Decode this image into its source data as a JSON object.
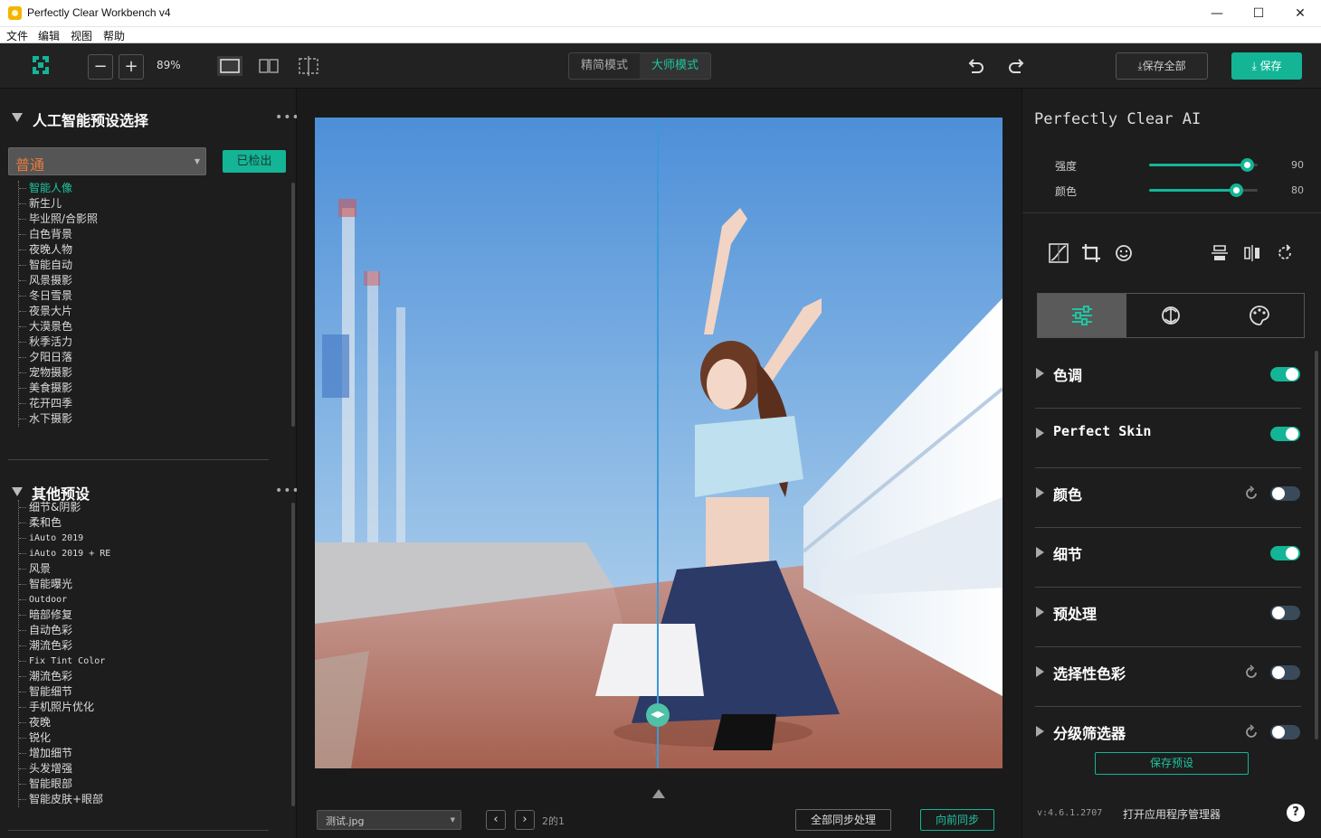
{
  "window": {
    "title": "Perfectly Clear Workbench v4",
    "minimize_glyph": "—",
    "maximize_glyph": "☐",
    "close_glyph": "✕"
  },
  "menu": [
    "文件",
    "编辑",
    "视图",
    "帮助"
  ],
  "toolbar": {
    "zoom": "89%",
    "zoom_out_glyph": "−",
    "zoom_in_glyph": "+",
    "mode_simple": "精简模式",
    "mode_master": "大师模式",
    "save_all": "⤓保存全部",
    "save": "⤓ 保存",
    "accent": "#13b596"
  },
  "left": {
    "ai_section_title": "人工智能预设选择",
    "dots": "•••",
    "preset_selected": "普通",
    "detected_button": "已检出",
    "ai_presets": [
      "智能人像",
      "新生儿",
      "毕业照/合影照",
      "白色背景",
      "夜晚人物",
      "智能自动",
      "风景摄影",
      "冬日雪景",
      "夜景大片",
      "大漠景色",
      "秋季活力",
      "夕阳日落",
      "宠物摄影",
      "美食摄影",
      "花开四季",
      "水下摄影"
    ],
    "other_section_title": "其他预设",
    "other_presets": [
      "细节&阴影",
      "柔和色",
      "iAuto 2019",
      "iAuto 2019 + RE",
      "风景",
      "智能曝光",
      "Outdoor",
      "暗部修复",
      "自动色彩",
      "潮流色彩",
      "Fix Tint Color",
      "潮流色彩",
      "智能细节",
      "手机照片优化",
      "夜晚",
      "锐化",
      "增加细节",
      "头发增强",
      "智能眼部",
      "智能皮肤+眼部"
    ]
  },
  "center": {
    "file_name": "测试.jpg",
    "prev_glyph": "‹",
    "next_glyph": "›",
    "page": "2的1",
    "handle_glyph": "◀▶",
    "sync_all": "全部同步处理",
    "sync_forward": "向前同步"
  },
  "right": {
    "ai_title": "Perfectly Clear AI",
    "sliders": [
      {
        "label": "强度",
        "value": 90,
        "display": "90"
      },
      {
        "label": "颜色",
        "value": 80,
        "display": "80"
      }
    ],
    "tools": [
      "curves-icon",
      "crop-icon",
      "face-icon",
      "flip-vertical-icon",
      "flip-horizontal-icon",
      "rotate-icon"
    ],
    "tabs": [
      "adjustments-tab",
      "ai-tab",
      "creative-tab"
    ],
    "adjustments": [
      {
        "label": "色调",
        "on": true,
        "reset": false
      },
      {
        "label": "Perfect Skin",
        "on": true,
        "reset": false
      },
      {
        "label": "颜色",
        "on": false,
        "reset": true
      },
      {
        "label": "细节",
        "on": true,
        "reset": false
      },
      {
        "label": "预处理",
        "on": false,
        "reset": false
      },
      {
        "label": "选择性色彩",
        "on": false,
        "reset": true
      },
      {
        "label": "分级筛选器",
        "on": false,
        "reset": true
      }
    ],
    "save_preset": "保存预设",
    "version": "v:4.6.1.2707",
    "app_manager": "打开应用程序管理器",
    "help": "?"
  }
}
